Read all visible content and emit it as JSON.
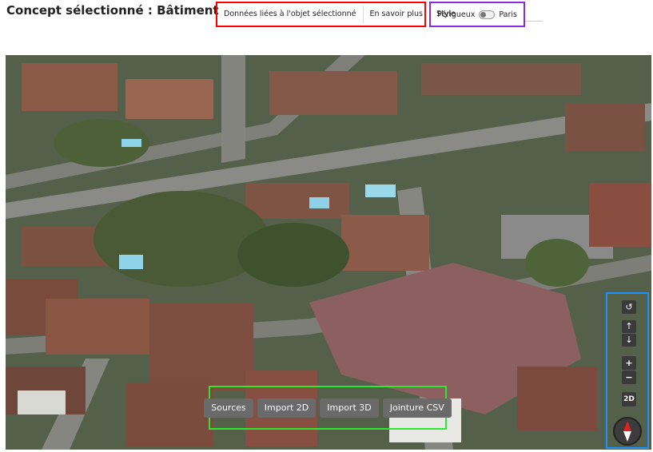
{
  "header": {
    "title": "Concept sélectionné : Bâtiment"
  },
  "toolbar": {
    "items": [
      "Données liées à l'objet sélectionné",
      "En savoir plus",
      "Style"
    ]
  },
  "city_toggle": {
    "left": "Périgueux",
    "right": "Paris",
    "selected": "Périgueux"
  },
  "map_controls": {
    "reset": "↺",
    "tilt_up": "↑",
    "tilt_down": "↓",
    "zoom_in": "+",
    "zoom_out": "−",
    "mode": "2D"
  },
  "bottom_actions": [
    "Sources",
    "Import 2D",
    "Import 3D",
    "Jointure CSV"
  ],
  "colors": {
    "highlight_toolbar": "#ff0000",
    "highlight_toggle": "#8a2be2",
    "highlight_actions": "#2ee82e",
    "highlight_controls": "#1e90ff",
    "button_bg": "#6a6a6a"
  },
  "icons": [
    "reset-view-icon",
    "arrow-up-icon",
    "arrow-down-icon",
    "plus-icon",
    "minus-icon",
    "compass-icon"
  ]
}
